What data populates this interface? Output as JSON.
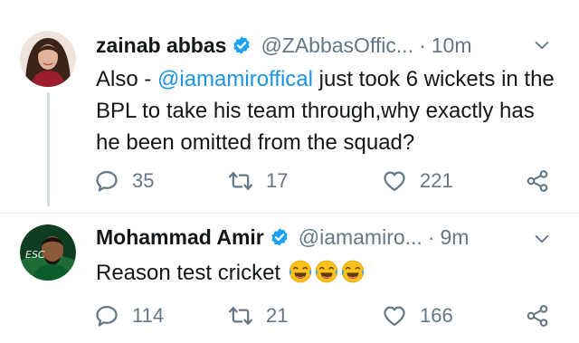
{
  "tweets": [
    {
      "author_name": "zainab abbas",
      "handle": "@ZAbbasOffic...",
      "separator": "·",
      "time": "10m",
      "text_prefix": "Also - ",
      "mention": "@iamamiroffical",
      "text_suffix": " just took 6 wickets in the BPL to take his team through,why exactly has he been omitted from the squad?",
      "reply_count": "35",
      "retweet_count": "17",
      "like_count": "221",
      "icons": [
        "verified-badge-icon",
        "chevron-down-icon",
        "reply-icon",
        "retweet-icon",
        "like-icon",
        "share-icon"
      ]
    },
    {
      "author_name": "Mohammad Amir",
      "handle": "@iamamiro...",
      "separator": "·",
      "time": "9m",
      "text": "Reason test cricket",
      "emojis": [
        "tears-of-joy-emoji",
        "tears-of-joy-emoji",
        "tears-of-joy-emoji"
      ],
      "reply_count": "114",
      "retweet_count": "21",
      "like_count": "166",
      "icons": [
        "verified-badge-icon",
        "chevron-down-icon",
        "reply-icon",
        "retweet-icon",
        "like-icon",
        "share-icon"
      ]
    }
  ],
  "colors": {
    "text": "#14171a",
    "secondary": "#657786",
    "mention": "#1b95e0",
    "verified": "#1da1f2",
    "thread_line": "#d4dce3"
  }
}
